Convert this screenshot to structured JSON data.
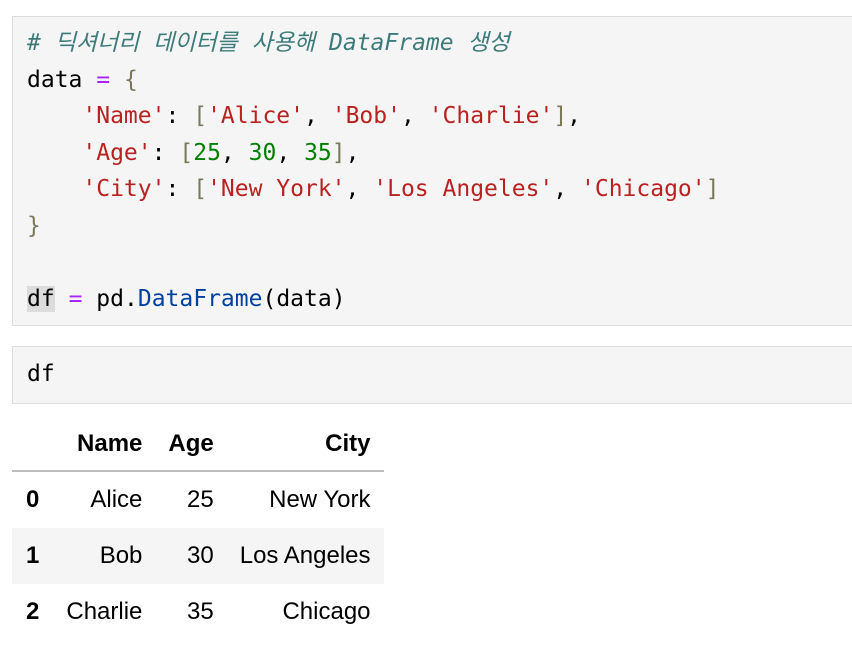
{
  "cell1": {
    "comment": "# 딕셔너리 데이터를 사용해 DataFrame 생성",
    "var_data": "data",
    "op_assign": "=",
    "brace_open": "{",
    "brace_close": "}",
    "key_name": "'Name'",
    "key_age": "'Age'",
    "key_city": "'City'",
    "colon": ":",
    "comma": ",",
    "space": " ",
    "bracket_open": "[",
    "bracket_close": "]",
    "names": [
      "'Alice'",
      "'Bob'",
      "'Charlie'"
    ],
    "ages": [
      "25",
      "30",
      "35"
    ],
    "cities": [
      "'New York'",
      "'Los Angeles'",
      "'Chicago'"
    ],
    "var_df": "df",
    "module": "pd",
    "dot": ".",
    "func": "DataFrame",
    "paren_open": "(",
    "paren_close": ")",
    "arg": "data"
  },
  "cell2": {
    "code": "df"
  },
  "table": {
    "columns": [
      "Name",
      "Age",
      "City"
    ],
    "rows": [
      {
        "index": "0",
        "name": "Alice",
        "age": "25",
        "city": "New York"
      },
      {
        "index": "1",
        "name": "Bob",
        "age": "30",
        "city": "Los Angeles"
      },
      {
        "index": "2",
        "name": "Charlie",
        "age": "35",
        "city": "Chicago"
      }
    ]
  }
}
